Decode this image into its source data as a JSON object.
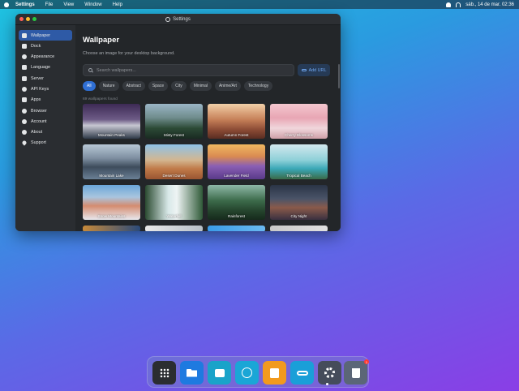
{
  "menubar": {
    "app_name": "Settings",
    "items": [
      "File",
      "View",
      "Window",
      "Help"
    ],
    "datetime": "sáb., 14 de mar. 02:36"
  },
  "window": {
    "title": "Settings"
  },
  "sidebar": {
    "items": [
      {
        "label": "Wallpaper",
        "icon": "image-icon"
      },
      {
        "label": "Dock",
        "icon": "dock-icon"
      },
      {
        "label": "Appearance",
        "icon": "palette-icon"
      },
      {
        "label": "Language",
        "icon": "translate-icon"
      },
      {
        "label": "Server",
        "icon": "server-icon"
      },
      {
        "label": "API Keys",
        "icon": "key-icon"
      },
      {
        "label": "Apps",
        "icon": "grid-icon"
      },
      {
        "label": "Browser",
        "icon": "globe-icon"
      },
      {
        "label": "Account",
        "icon": "user-icon"
      },
      {
        "label": "About",
        "icon": "info-icon"
      },
      {
        "label": "Support",
        "icon": "heart-icon"
      }
    ]
  },
  "main": {
    "title": "Wallpaper",
    "subtitle": "Choose an image for your desktop background.",
    "search_placeholder": "Search wallpapers...",
    "add_url_label": "Add URL",
    "categories": [
      "All",
      "Nature",
      "Abstract",
      "Space",
      "City",
      "Minimal",
      "Anime/Art",
      "Technology"
    ],
    "active_category": "All",
    "count_text": "69 wallpapers found",
    "wallpapers": [
      {
        "label": "Mountain Peaks"
      },
      {
        "label": "Misty Forest"
      },
      {
        "label": "Autumn Forest"
      },
      {
        "label": "Cherry Blossoms"
      },
      {
        "label": "Mountain Lake"
      },
      {
        "label": "Desert Dunes"
      },
      {
        "label": "Lavender Field"
      },
      {
        "label": "Tropical Beach"
      },
      {
        "label": "Snow Mountains"
      },
      {
        "label": "Waterfall"
      },
      {
        "label": "Rainforest"
      },
      {
        "label": "City Night"
      }
    ]
  },
  "dock": {
    "apps": [
      {
        "name": "launchpad-icon",
        "color": "#2b2d31"
      },
      {
        "name": "files-icon",
        "color": "#1e7ae0"
      },
      {
        "name": "messages-icon",
        "color": "#19a3c9"
      },
      {
        "name": "browser-icon",
        "color": "#1aa6d6"
      },
      {
        "name": "notes-icon",
        "color": "#f29a1e"
      },
      {
        "name": "link-icon",
        "color": "#1a9fd8"
      },
      {
        "name": "settings-icon",
        "color": "#454c5a"
      },
      {
        "name": "trash-icon",
        "color": "#5b6677"
      }
    ],
    "trash_badge": "1"
  }
}
